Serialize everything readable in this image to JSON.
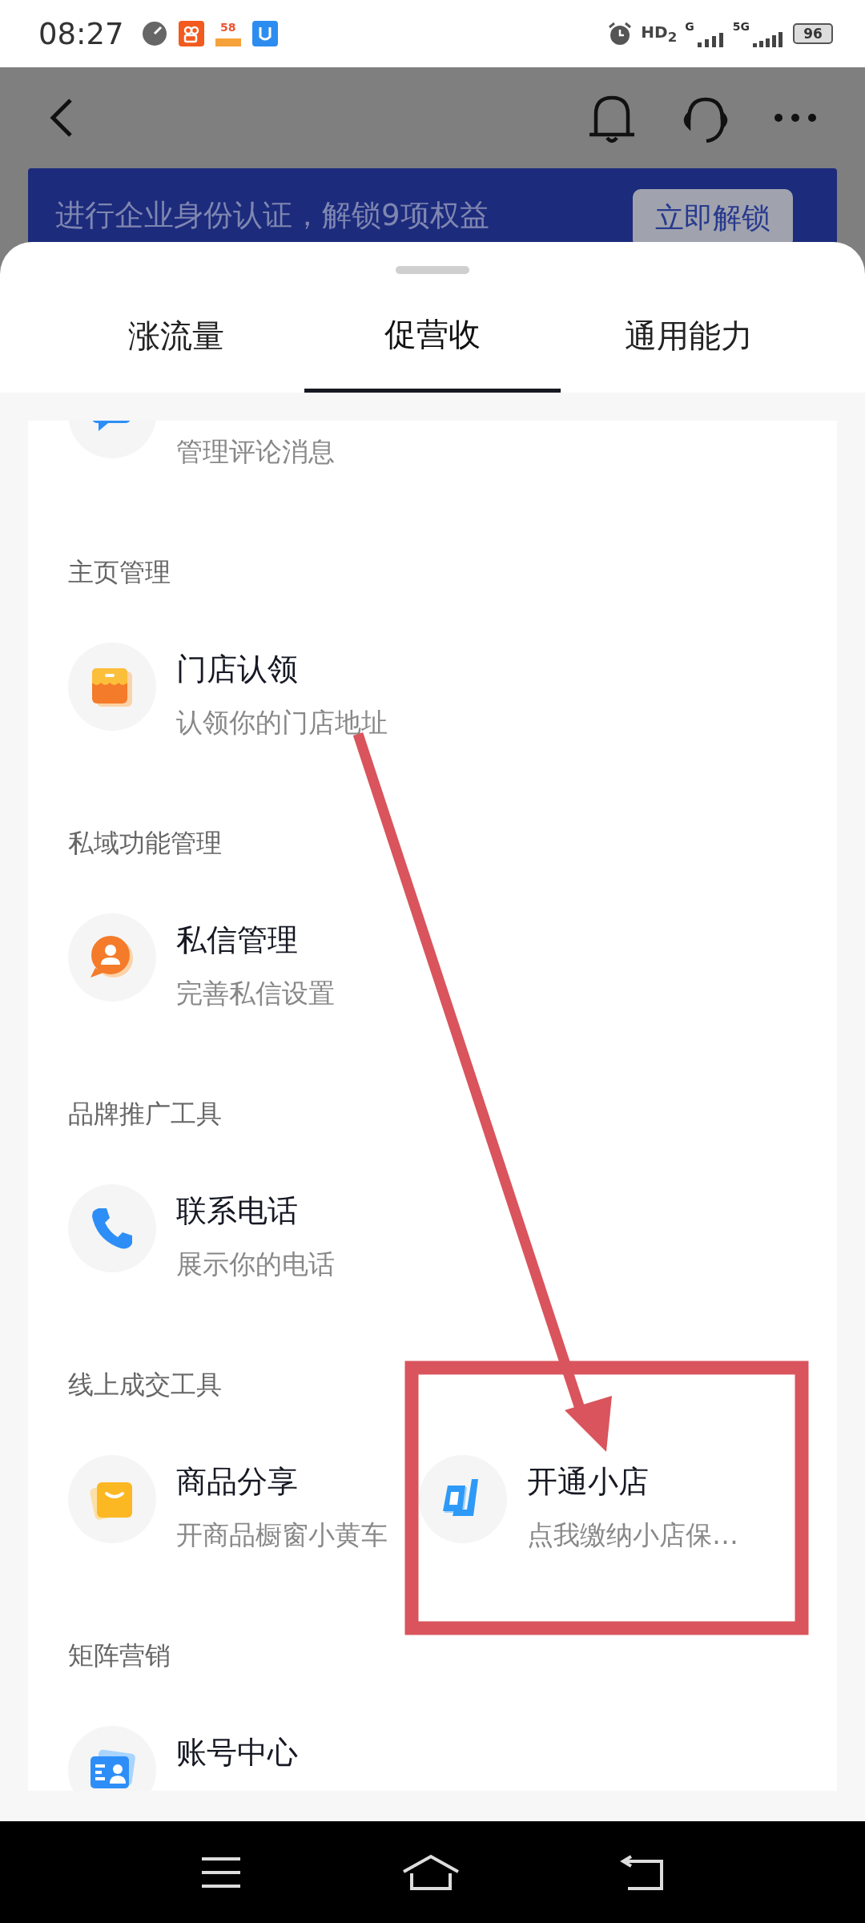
{
  "status_bar": {
    "time": "08:27",
    "app_label": "58",
    "hd_label": "HD$_{2}$",
    "signal_labels": [
      "G",
      "5G"
    ],
    "battery": "96"
  },
  "banner": {
    "text": "进行企业身份认证，解锁9项权益",
    "button": "立即解锁"
  },
  "tabs": [
    {
      "label": "涨流量",
      "selected": false
    },
    {
      "label": "促营收",
      "selected": true
    },
    {
      "label": "通用能力",
      "selected": false
    }
  ],
  "sections": [
    {
      "items": [
        {
          "subtitle": "管理评论消息"
        }
      ]
    },
    {
      "heading": "主页管理",
      "items": [
        {
          "title": "门店认领",
          "subtitle": "认领你的门店地址"
        }
      ]
    },
    {
      "heading": "私域功能管理",
      "items": [
        {
          "title": "私信管理",
          "subtitle": "完善私信设置"
        }
      ]
    },
    {
      "heading": "品牌推广工具",
      "items": [
        {
          "title": "联系电话",
          "subtitle": "展示你的电话"
        }
      ]
    },
    {
      "heading": "线上成交工具",
      "items": [
        {
          "title": "商品分享",
          "subtitle": "开商品橱窗小黄车"
        },
        {
          "title": "开通小店",
          "subtitle": "点我缴纳小店保…"
        }
      ]
    },
    {
      "heading": "矩阵营销",
      "items": [
        {
          "title": "账号中心"
        }
      ]
    }
  ]
}
